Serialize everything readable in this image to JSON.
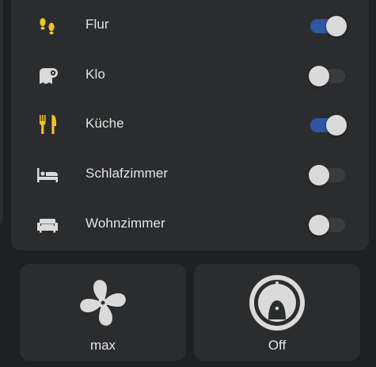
{
  "rooms": [
    {
      "label": "Flur",
      "icon": "footprints-icon",
      "on": true
    },
    {
      "label": "Klo",
      "icon": "toilet-paper-icon",
      "on": false
    },
    {
      "label": "Küche",
      "icon": "fork-knife-icon",
      "on": true
    },
    {
      "label": "Schlafzimmer",
      "icon": "bed-icon",
      "on": false
    },
    {
      "label": "Wohnzimmer",
      "icon": "sofa-icon",
      "on": false
    }
  ],
  "tiles": {
    "fan": {
      "label": "max",
      "icon": "fan-icon"
    },
    "vacuum": {
      "label": "Off",
      "icon": "robot-vacuum-icon"
    }
  },
  "colors": {
    "background": "#1f2022",
    "card": "#2b2c2e",
    "active_icon": "#f2c22c",
    "inactive_icon": "#dadada",
    "toggle_on_track": "#2f56a0",
    "toggle_off_track": "#3a3b3d"
  }
}
